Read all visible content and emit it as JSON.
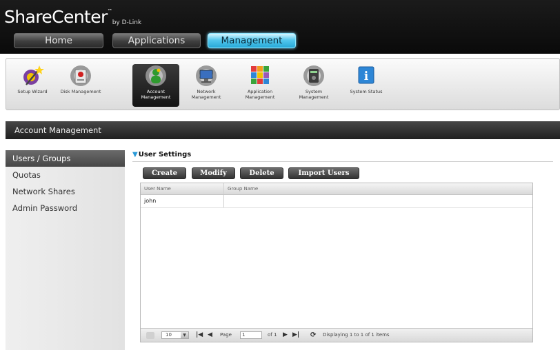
{
  "brand": {
    "name": "ShareCenter",
    "tm": "™",
    "by": "by D-Link"
  },
  "nav": {
    "home": "Home",
    "applications": "Applications",
    "management": "Management"
  },
  "toolbar": {
    "items": [
      {
        "label": "Setup Wizard"
      },
      {
        "label": "Disk Management"
      },
      {
        "label": "Account Management"
      },
      {
        "label": "Network Management"
      },
      {
        "label": "Application Management"
      },
      {
        "label": "System Management"
      },
      {
        "label": "System Status"
      }
    ]
  },
  "section": {
    "title": "Account Management"
  },
  "sidebar": {
    "items": [
      {
        "label": "Users / Groups"
      },
      {
        "label": "Quotas"
      },
      {
        "label": "Network Shares"
      },
      {
        "label": "Admin Password"
      }
    ]
  },
  "content": {
    "title": "User Settings",
    "buttons": {
      "create": "Create",
      "modify": "Modify",
      "delete": "Delete",
      "import": "Import Users"
    }
  },
  "table": {
    "columns": [
      "User Name",
      "Group Name"
    ],
    "rows": [
      {
        "user": "john",
        "group": ""
      }
    ]
  },
  "pager": {
    "per_page": "10",
    "page_label": "Page",
    "page_value": "1",
    "of_label": "of 1",
    "status": "Displaying 1 to 1 of 1 items"
  },
  "colors": {
    "accent": "#2a9ad8",
    "active_tab": "#55c8ee",
    "header_bg": "#111111"
  }
}
